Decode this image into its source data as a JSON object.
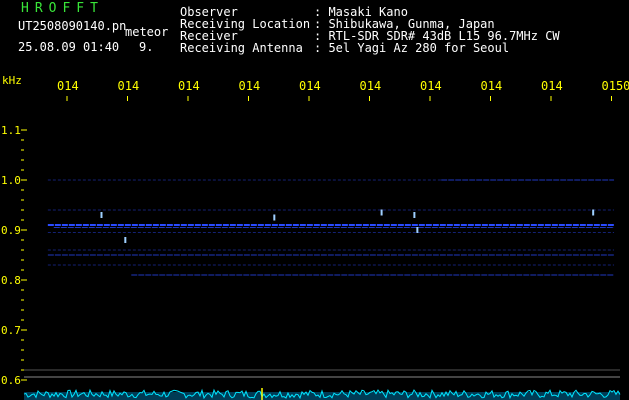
{
  "header": {
    "brand": "HROFFT",
    "filename": "UT2508090140.pn",
    "meteor_label": "meteor",
    "datetime": "25.08.09 01:40",
    "count": "9.",
    "fields": [
      {
        "key": "Observer",
        "value": ": Masaki Kano"
      },
      {
        "key": "Receiving Location",
        "value": ": Shibukawa, Gunma, Japan"
      },
      {
        "key": "Receiver",
        "value": ": RTL-SDR SDR# 43dB L15 96.7MHz CW"
      },
      {
        "key": "Receiving Antenna",
        "value": ": 5el Yagi Az 280 for Seoul"
      }
    ]
  },
  "chart_data": {
    "type": "heatmap",
    "y_unit_label": "kHz",
    "y_ticks": [
      "1.1",
      "1.0",
      "0.9",
      "0.8",
      "0.7",
      "0.6"
    ],
    "y_tick_values": [
      1.1,
      1.0,
      0.9,
      0.8,
      0.7,
      0.6
    ],
    "x_ticks": [
      "014",
      "014",
      "014",
      "014",
      "014",
      "014",
      "014",
      "014",
      "014",
      "0150"
    ],
    "colors": {
      "background": "#000000",
      "axis_label": "#ffff00",
      "grid": "#555555",
      "signal": "#2a4bff",
      "signal_strong": "#9fd0ff",
      "baseline": "#00e5ff"
    },
    "traces": [
      {
        "y": 0.91,
        "x_start": 0.04,
        "x_end": 0.99,
        "strength": "strong"
      },
      {
        "y": 0.905,
        "x_start": 0.05,
        "x_end": 0.99,
        "strength": "medium"
      },
      {
        "y": 0.895,
        "x_start": 0.04,
        "x_end": 0.99,
        "strength": "weak"
      },
      {
        "y": 0.85,
        "x_start": 0.04,
        "x_end": 0.99,
        "strength": "medium"
      },
      {
        "y": 0.81,
        "x_start": 0.18,
        "x_end": 0.99,
        "strength": "medium"
      },
      {
        "y": 1.0,
        "x_start": 0.7,
        "x_end": 0.99,
        "strength": "medium"
      },
      {
        "y": 1.0,
        "x_start": 0.04,
        "x_end": 0.7,
        "strength": "weak"
      },
      {
        "y": 0.94,
        "x_start": 0.04,
        "x_end": 0.99,
        "strength": "weak"
      },
      {
        "y": 0.86,
        "x_start": 0.04,
        "x_end": 0.99,
        "strength": "weak"
      },
      {
        "y": 0.83,
        "x_start": 0.04,
        "x_end": 0.99,
        "strength": "weak"
      }
    ],
    "meteor_pings": [
      {
        "x": 0.13,
        "y": 0.93
      },
      {
        "x": 0.17,
        "y": 0.88
      },
      {
        "x": 0.42,
        "y": 0.925
      },
      {
        "x": 0.6,
        "y": 0.935
      },
      {
        "x": 0.655,
        "y": 0.93
      },
      {
        "x": 0.66,
        "y": 0.9
      },
      {
        "x": 0.955,
        "y": 0.935
      }
    ]
  }
}
